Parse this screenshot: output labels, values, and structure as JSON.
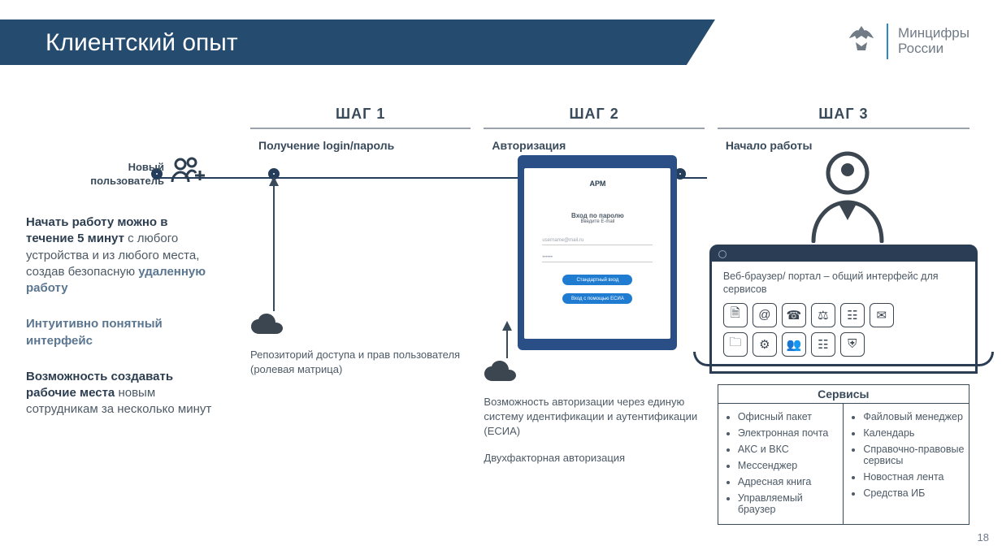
{
  "header": {
    "title": "Клиентский опыт"
  },
  "logo": {
    "line1": "Минцифры",
    "line2": "России"
  },
  "left": {
    "user_label_1": "Новый",
    "user_label_2": "пользователь",
    "p1_bold": "Начать работу можно в течение 5 минут",
    "p1_rest_a": " с любого устройства и из любого места, создав безопасную ",
    "p1_accent": "удаленную работу",
    "p2": "Интуитивно понятный интерфейс",
    "p3_bold": "Возможность создавать рабочие места",
    "p3_rest": " новым сотрудникам за несколько минут"
  },
  "steps": {
    "s1": {
      "title": "ШАГ 1",
      "sub": "Получение login/пароль",
      "caption": "Репозиторий доступа и прав пользователя (ролевая матрица)"
    },
    "s2": {
      "title": "ШАГ 2",
      "sub": "Авторизация",
      "caption1": "Возможность авторизации через единую систему идентификации и аутентификации (ЕСИА)",
      "caption2": "Двухфакторная авторизация"
    },
    "s3": {
      "title": "ШАГ 3",
      "sub": "Начало работы",
      "screen_text": "Веб-браузер/ портал – общий интерфейс для сервисов"
    }
  },
  "tablet": {
    "brand": "АРМ",
    "login_title": "Вход по паролю",
    "login_sub": "Введите E-mail",
    "field1": "username@mail.ru",
    "field2": "••••••",
    "btn1": "Стандартный вход",
    "btn2": "Вход с помощью ЕСИА"
  },
  "services": {
    "title": "Сервисы",
    "col1": [
      "Офисный пакет",
      "Электронная почта",
      "АКС и ВКС",
      "Мессенджер",
      "Адресная книга",
      "Управляемый браузер"
    ],
    "col2": [
      "Файловый менеджер",
      "Календарь",
      "Справочно-правовые сервисы",
      "Новостная лента",
      "Средства ИБ"
    ]
  },
  "page_number": "18"
}
